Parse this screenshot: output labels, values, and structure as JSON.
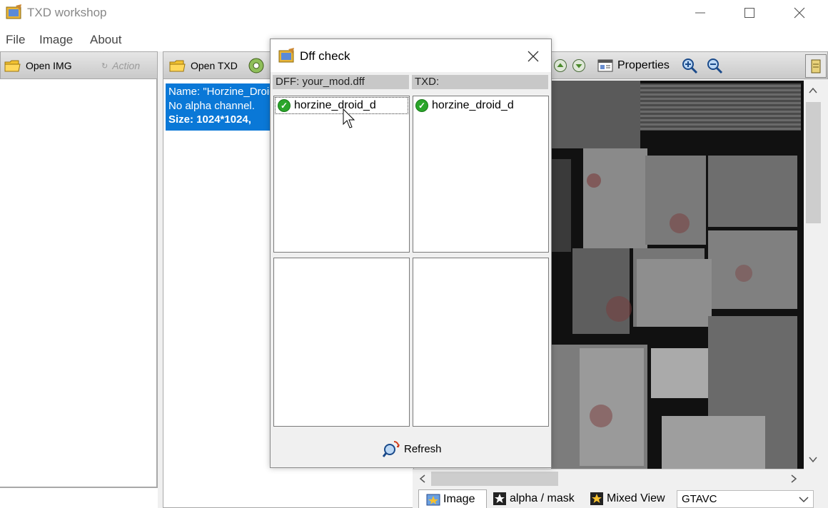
{
  "window": {
    "title": "TXD workshop"
  },
  "menu": [
    "File",
    "Image",
    "About"
  ],
  "left_toolbar": {
    "open_img": "Open IMG",
    "action": "Action"
  },
  "mid_toolbar": {
    "open_txd": "Open TXD",
    "properties": "Properties"
  },
  "texture_item": {
    "line1": "Name: \"Horzine_Droid_d\"",
    "line2": "No alpha channel.",
    "line3": "Size: 1024*1024,"
  },
  "dialog": {
    "title": "Dff check",
    "dff_header": "DFF: your_mod.dff",
    "txd_header": "TXD:",
    "dff_items": [
      "horzine_droid_d"
    ],
    "txd_items": [
      "horzine_droid_d"
    ],
    "refresh": "Refresh"
  },
  "bottom_tabs": {
    "image": "Image",
    "alpha": "alpha / mask",
    "mixed": "Mixed View"
  },
  "game_select": {
    "value": "GTAVC"
  }
}
